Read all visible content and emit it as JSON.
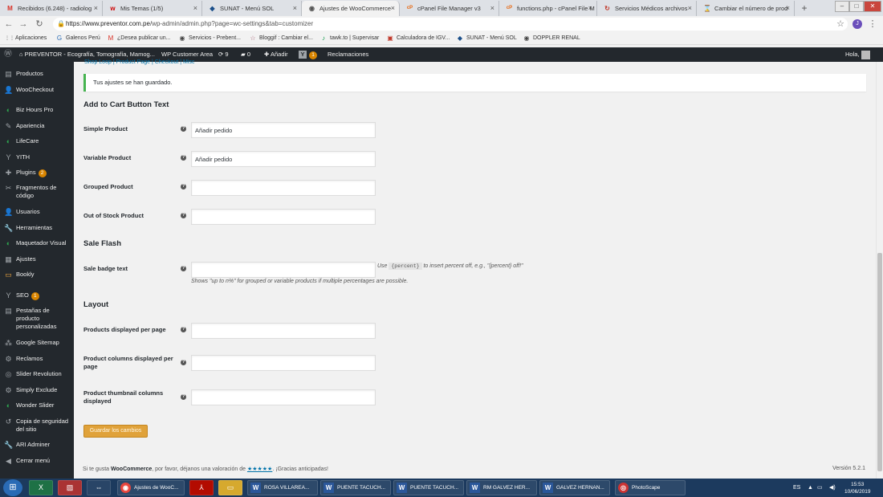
{
  "browser": {
    "tabs": [
      {
        "icon": "M",
        "title": "Recibidos (6.248) - radiolog"
      },
      {
        "icon": "w",
        "title": "Mis Temas (1/5)"
      },
      {
        "icon": "◆",
        "title": "SUNAT - Menú SOL"
      },
      {
        "icon": "◉",
        "title": "Ajustes de WooCommerce",
        "active": true
      },
      {
        "icon": "cP",
        "title": "cPanel File Manager v3"
      },
      {
        "icon": "cP",
        "title": "functions.php - cPanel File M"
      },
      {
        "icon": "↻",
        "title": "Servicios Médicos archivos"
      },
      {
        "icon": "⌛",
        "title": "Cambiar el número de prod"
      }
    ],
    "url_prefix": "https://www.preventor.com.pe",
    "url_rest": "/wp-admin/admin.php?page=wc-settings&tab=customizer",
    "bookmarks": [
      {
        "icon": "⋮⋮",
        "label": "Aplicaciones"
      },
      {
        "icon": "G",
        "label": "Galenos Perú"
      },
      {
        "icon": "M",
        "label": "¿Desea publicar un..."
      },
      {
        "icon": "◉",
        "label": "Servicios - Prebent..."
      },
      {
        "icon": "☆",
        "label": "Bloggif : Cambiar el..."
      },
      {
        "icon": "♪",
        "label": "tawk.to | Supervisar"
      },
      {
        "icon": "▣",
        "label": "Calculadora de IGV..."
      },
      {
        "icon": "◆",
        "label": "SUNAT - Menú SOL"
      },
      {
        "icon": "◉",
        "label": "DOPPLER RENAL"
      }
    ],
    "profile_initial": "J"
  },
  "adminbar": {
    "site": "PREVENTOR - Ecografía, Tomografía, Mamog...",
    "customer_area": "WP Customer Area",
    "updates": "9",
    "comments": "0",
    "add_new": "Añadir",
    "yoast_count": "1",
    "claims": "Reclamaciones",
    "greeting": "Hola,"
  },
  "sidebar": {
    "items": [
      {
        "icon": "▤",
        "label": "Productos"
      },
      {
        "icon": "👤",
        "label": "WooCheckout"
      },
      {
        "icon": "◐",
        "label": "Biz Hours Pro"
      },
      {
        "icon": "✎",
        "label": "Apariencia"
      },
      {
        "icon": "◐",
        "label": "LifeCare"
      },
      {
        "icon": "Y",
        "label": "YITH"
      },
      {
        "icon": "✚",
        "label": "Plugins",
        "badge": "2"
      },
      {
        "icon": "✂",
        "label": "Fragmentos de código"
      },
      {
        "icon": "👤",
        "label": "Usuarios"
      },
      {
        "icon": "🔧",
        "label": "Herramientas"
      },
      {
        "icon": "◐",
        "label": "Maquetador Visual"
      },
      {
        "icon": "▦",
        "label": "Ajustes"
      },
      {
        "icon": "▭",
        "label": "Bookly"
      },
      {
        "icon": "Y",
        "label": "SEO",
        "badge": "1"
      },
      {
        "icon": "▤",
        "label": "Pestañas de producto personalizadas"
      },
      {
        "icon": "⁂",
        "label": "Google Sitemap"
      },
      {
        "icon": "⚙",
        "label": "Reclamos"
      },
      {
        "icon": "◎",
        "label": "Slider Revolution"
      },
      {
        "icon": "⚙",
        "label": "Simply Exclude"
      },
      {
        "icon": "◐",
        "label": "Wonder Slider"
      },
      {
        "icon": "↺",
        "label": "Copia de seguridad del sitio"
      },
      {
        "icon": "🔧",
        "label": "ARI Adminer"
      },
      {
        "icon": "◀",
        "label": "Cerrar menú"
      }
    ]
  },
  "main": {
    "subnav": [
      "Shop Loop",
      "Product Page",
      "Checkout",
      "Misc"
    ],
    "notice": "Tus ajustes se han guardado.",
    "sections": {
      "add_to_cart": "Add to Cart Button Text",
      "sale_flash": "Sale Flash",
      "layout": "Layout"
    },
    "fields": {
      "simple_product": {
        "label": "Simple Product",
        "value": "Añadir pedido"
      },
      "variable_product": {
        "label": "Variable Product",
        "value": "Añadir pedido"
      },
      "grouped_product": {
        "label": "Grouped Product",
        "value": ""
      },
      "out_of_stock": {
        "label": "Out of Stock Product",
        "value": ""
      },
      "sale_badge": {
        "label": "Sale badge text",
        "value": ""
      },
      "products_per_page": {
        "label": "Products displayed per page",
        "value": ""
      },
      "product_columns": {
        "label": "Product columns displayed per page",
        "value": ""
      },
      "thumbnail_columns": {
        "label": "Product thumbnail columns displayed",
        "value": ""
      }
    },
    "sale_hint_pre": "Use",
    "sale_hint_code": "{percent}",
    "sale_hint_post": "to insert percent off, e.g., \"{percent} off!\"",
    "sale_desc": "Shows \"up to n%\" for grouped or variable products if multiple percentages are possible.",
    "save_button": "Guardar los cambios",
    "footer_pre": "Si te gusta",
    "footer_brand": "WooCommerce",
    "footer_mid": ", por favor, déjanos una valoración de",
    "footer_stars": "★★★★★",
    "footer_post": ". ¡Gracias anticipadas!",
    "version": "Versión 5.2.1"
  },
  "taskbar": {
    "tasks": [
      {
        "icon": "◉",
        "label": "Ajustes de WooC..."
      },
      {
        "icon": "W",
        "label": "ROSA VILLAREA..."
      },
      {
        "icon": "W",
        "label": "PUENTE TACUCH..."
      },
      {
        "icon": "W",
        "label": "PUENTE TACUCH..."
      },
      {
        "icon": "W",
        "label": "RM GALVEZ HER..."
      },
      {
        "icon": "W",
        "label": "GALVEZ HERNAN..."
      },
      {
        "icon": "◎",
        "label": "PhotoScape"
      }
    ],
    "lang": "ES",
    "time": "15:53",
    "date": "10/06/2019"
  }
}
